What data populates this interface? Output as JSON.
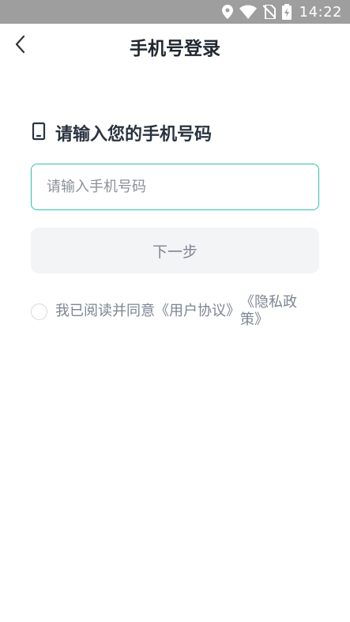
{
  "status_bar": {
    "time": "14:22",
    "icons": [
      "location-icon",
      "wifi-icon",
      "no-sim-icon",
      "battery-charging-icon"
    ]
  },
  "nav": {
    "title": "手机号登录",
    "back_icon": "chevron-left-icon"
  },
  "form": {
    "heading": "请输入您的手机号码",
    "heading_icon": "phone-icon",
    "phone_placeholder": "请输入手机号码",
    "phone_value": "",
    "next_label": "下一步",
    "accent_color": "#2ec3a5"
  },
  "agreement": {
    "prefix": "我已阅读并同意",
    "user_agreement": "《用户协议》",
    "privacy_policy": "《隐私政策》",
    "checked": false
  }
}
